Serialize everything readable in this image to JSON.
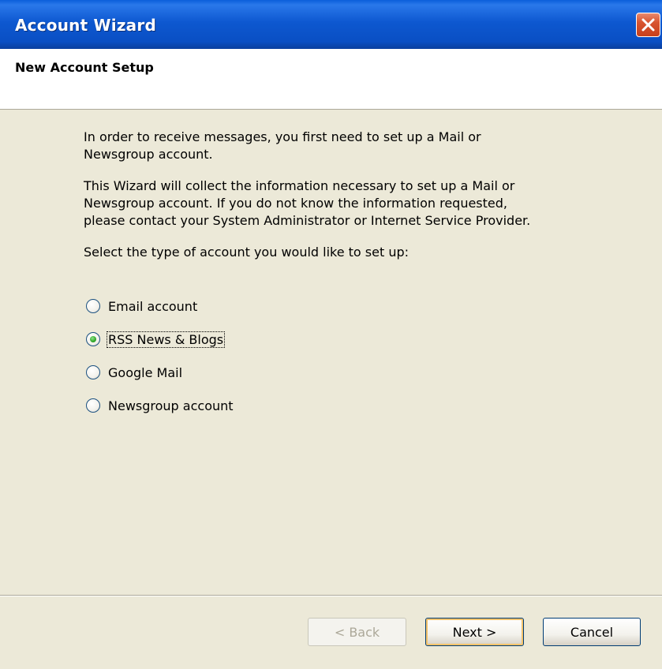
{
  "window": {
    "title": "Account Wizard"
  },
  "header": {
    "title": "New Account Setup"
  },
  "content": {
    "intro_line1": "In order to receive messages, you first need to set up a Mail or",
    "intro_line2": "Newsgroup account.",
    "info_line1": "This Wizard will collect the information necessary to set up a Mail or",
    "info_line2": "Newsgroup account. If you do not know the information requested,",
    "info_line3": "please contact your System Administrator or Internet Service Provider.",
    "select_prompt": "Select the type of account you would like to set up:"
  },
  "account_types": {
    "selected": "RSS News & Blogs",
    "options": [
      {
        "label": "Email account",
        "checked": false
      },
      {
        "label": "RSS News & Blogs",
        "checked": true
      },
      {
        "label": "Google Mail",
        "checked": false
      },
      {
        "label": "Newsgroup account",
        "checked": false
      }
    ]
  },
  "buttons": {
    "back": "< Back",
    "next": "Next >",
    "cancel": "Cancel"
  },
  "colors": {
    "titlebar": "#0a5edb",
    "dialog_bg": "#ece9d8",
    "close_button": "#d8542f"
  },
  "icons": {
    "close": "close-x-icon"
  }
}
